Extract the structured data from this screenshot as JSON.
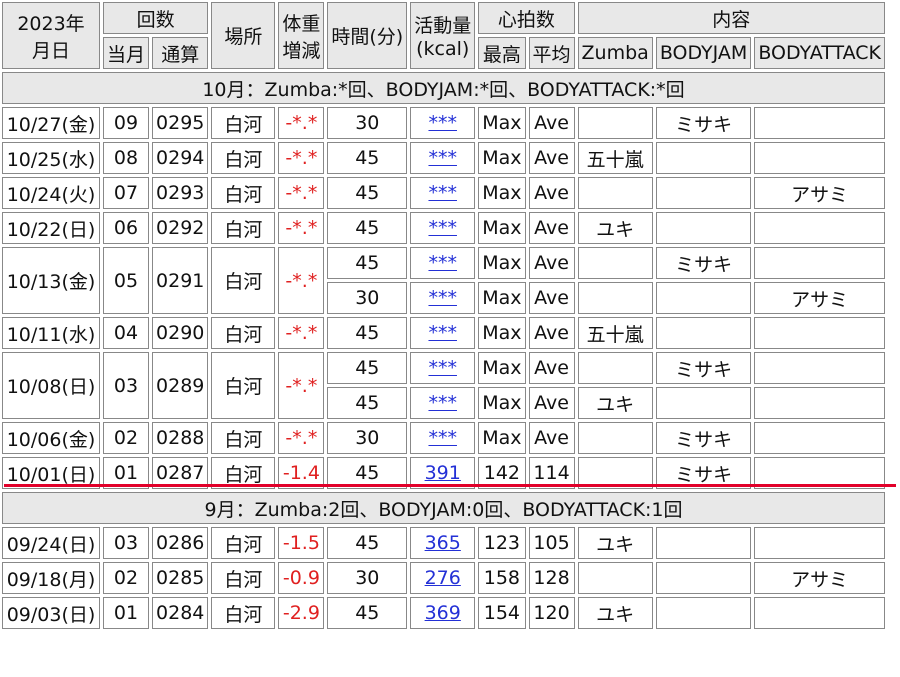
{
  "headers": {
    "year": "2023年",
    "date": "月日",
    "count": "回数",
    "count_month": "当月",
    "count_total": "通算",
    "place": "場所",
    "weight_1": "体重",
    "weight_2": "増減",
    "time": "時間(分)",
    "activity": "活動量",
    "kcal": "(kcal)",
    "heart": "心拍数",
    "hr_max": "最高",
    "hr_avg": "平均",
    "content": "内容",
    "zumba": "Zumba",
    "bodyjam": "BODYJAM",
    "bodyattack": "BODYATTACK"
  },
  "months": {
    "oct": "10月：Zumba:*回、BODYJAM:*回、BODYATTACK:*回",
    "sep": "9月：Zumba:2回、BODYJAM:0回、BODYATTACK:1回"
  },
  "rows": {
    "r1": {
      "date": "10/27(金)",
      "m": "09",
      "t": "0295",
      "place": "白河",
      "w": "-*.*",
      "min": "30",
      "kcal": "***",
      "max": "Max",
      "avg": "Ave",
      "zumba": "",
      "jam": "ミサキ",
      "attack": ""
    },
    "r2": {
      "date": "10/25(水)",
      "m": "08",
      "t": "0294",
      "place": "白河",
      "w": "-*.*",
      "min": "45",
      "kcal": "***",
      "max": "Max",
      "avg": "Ave",
      "zumba": "五十嵐",
      "jam": "",
      "attack": ""
    },
    "r3": {
      "date": "10/24(火)",
      "m": "07",
      "t": "0293",
      "place": "白河",
      "w": "-*.*",
      "min": "45",
      "kcal": "***",
      "max": "Max",
      "avg": "Ave",
      "zumba": "",
      "jam": "",
      "attack": "アサミ"
    },
    "r4": {
      "date": "10/22(日)",
      "m": "06",
      "t": "0292",
      "place": "白河",
      "w": "-*.*",
      "min": "45",
      "kcal": "***",
      "max": "Max",
      "avg": "Ave",
      "zumba": "ユキ",
      "jam": "",
      "attack": ""
    },
    "r5": {
      "date": "10/13(金)",
      "m": "05",
      "t": "0291",
      "place": "白河",
      "w": "-*.*",
      "s1": {
        "min": "45",
        "kcal": "***",
        "max": "Max",
        "avg": "Ave",
        "zumba": "",
        "jam": "ミサキ",
        "attack": ""
      },
      "s2": {
        "min": "30",
        "kcal": "***",
        "max": "Max",
        "avg": "Ave",
        "zumba": "",
        "jam": "",
        "attack": "アサミ"
      }
    },
    "r6": {
      "date": "10/11(水)",
      "m": "04",
      "t": "0290",
      "place": "白河",
      "w": "-*.*",
      "min": "45",
      "kcal": "***",
      "max": "Max",
      "avg": "Ave",
      "zumba": "五十嵐",
      "jam": "",
      "attack": ""
    },
    "r7": {
      "date": "10/08(日)",
      "m": "03",
      "t": "0289",
      "place": "白河",
      "w": "-*.*",
      "s1": {
        "min": "45",
        "kcal": "***",
        "max": "Max",
        "avg": "Ave",
        "zumba": "",
        "jam": "ミサキ",
        "attack": ""
      },
      "s2": {
        "min": "45",
        "kcal": "***",
        "max": "Max",
        "avg": "Ave",
        "zumba": "ユキ",
        "jam": "",
        "attack": ""
      }
    },
    "r8": {
      "date": "10/06(金)",
      "m": "02",
      "t": "0288",
      "place": "白河",
      "w": "-*.*",
      "min": "30",
      "kcal": "***",
      "max": "Max",
      "avg": "Ave",
      "zumba": "",
      "jam": "ミサキ",
      "attack": ""
    },
    "r9": {
      "date": "10/01(日)",
      "m": "01",
      "t": "0287",
      "place": "白河",
      "w": "-1.4",
      "min": "45",
      "kcal": "391",
      "max": "142",
      "avg": "114",
      "zumba": "",
      "jam": "ミサキ",
      "attack": ""
    },
    "s1": {
      "date": "09/24(日)",
      "m": "03",
      "t": "0286",
      "place": "白河",
      "w": "-1.5",
      "min": "45",
      "kcal": "365",
      "max": "123",
      "avg": "105",
      "zumba": "ユキ",
      "jam": "",
      "attack": ""
    },
    "s2": {
      "date": "09/18(月)",
      "m": "02",
      "t": "0285",
      "place": "白河",
      "w": "-0.9",
      "min": "30",
      "kcal": "276",
      "max": "158",
      "avg": "128",
      "zumba": "",
      "jam": "",
      "attack": "アサミ"
    },
    "s3": {
      "date": "09/03(日)",
      "m": "01",
      "t": "0284",
      "place": "白河",
      "w": "-2.9",
      "min": "45",
      "kcal": "369",
      "max": "154",
      "avg": "120",
      "zumba": "ユキ",
      "jam": "",
      "attack": ""
    }
  },
  "colors": {
    "weight_text": "#e02020",
    "link": "#2330d6",
    "divider_line": "#e2002a",
    "header_bg": "#e8e8e8"
  }
}
